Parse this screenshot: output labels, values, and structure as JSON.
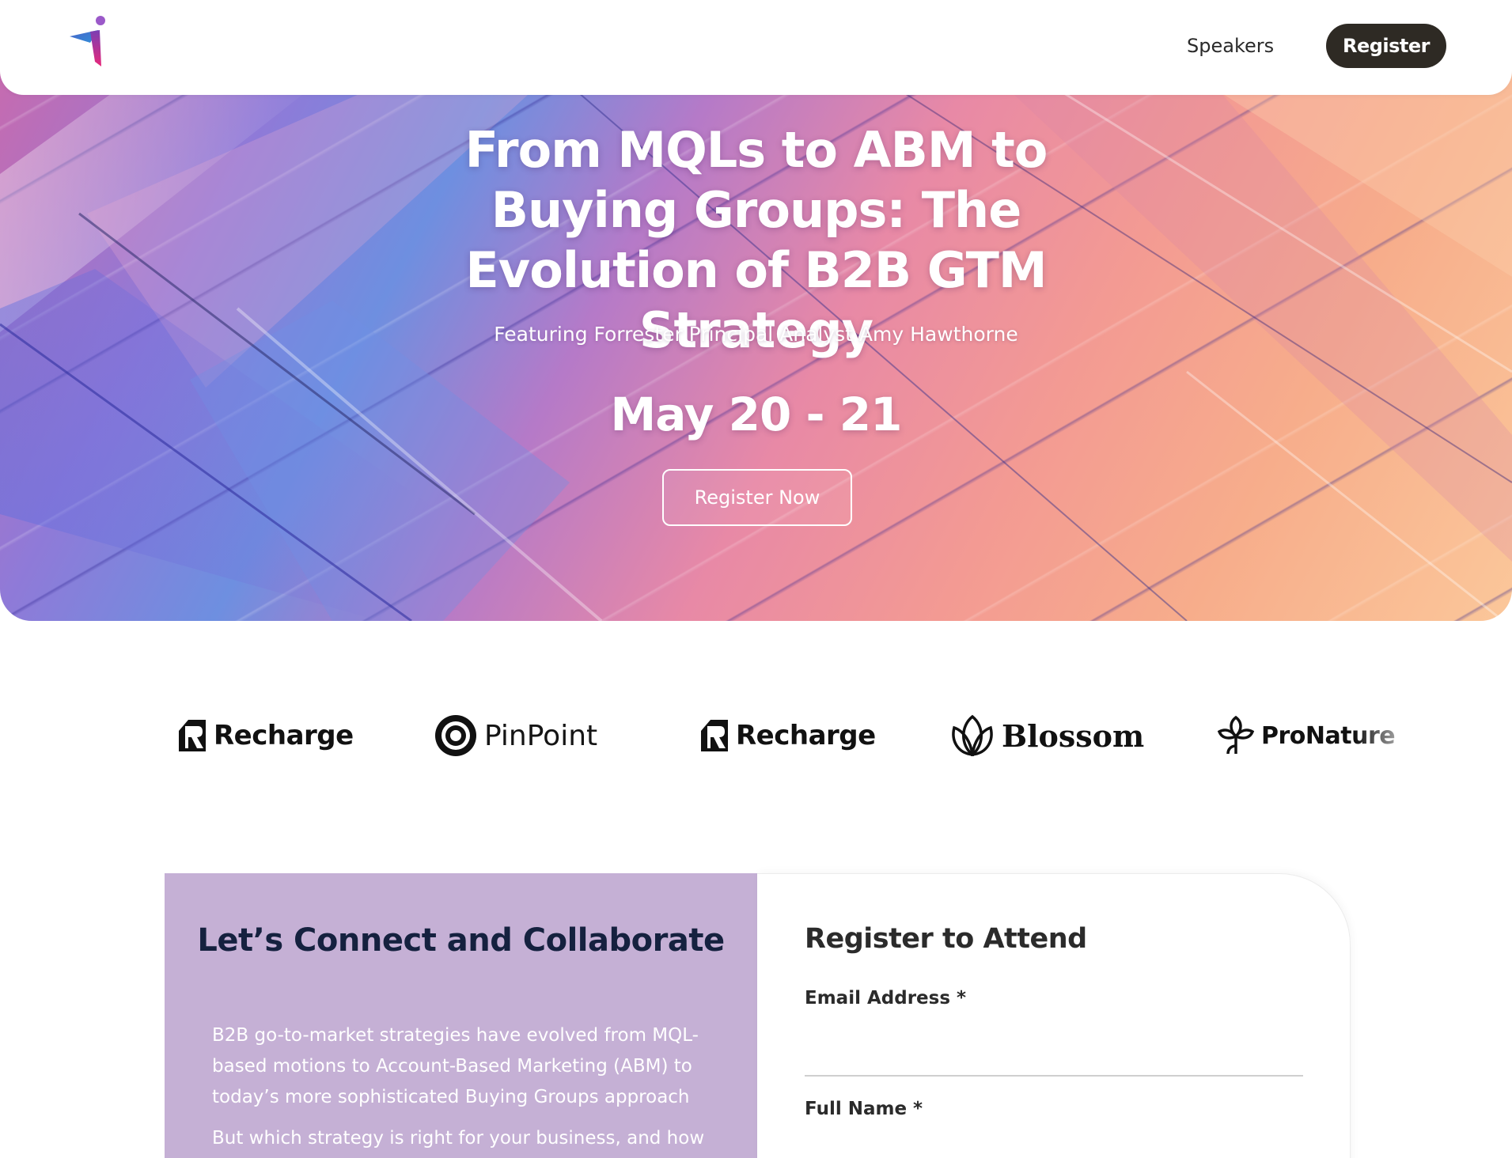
{
  "header": {
    "nav_speakers": "Speakers",
    "nav_register": "Register"
  },
  "hero": {
    "title": "From MQLs to ABM to Buying Groups: The Evolution of B2B GTM Strategy",
    "subtitle": "Featuring Forrester Principal Analyst Amy Hawthorne",
    "date": "May 20 - 21",
    "cta": "Register Now"
  },
  "logos": [
    {
      "name": "Recharge",
      "icon": "recharge-logo-icon"
    },
    {
      "name": "PinPoint",
      "icon": "pinpoint-logo-icon"
    },
    {
      "name": "Recharge",
      "icon": "recharge-logo-icon"
    },
    {
      "name": "Blossom",
      "icon": "blossom-logo-icon"
    },
    {
      "name": "ProNature",
      "icon": "pronature-logo-icon"
    }
  ],
  "connect": {
    "heading": "Let’s Connect and Collaborate",
    "paragraph1": "B2B go-to-market strategies have evolved from MQL-based motions to Account-Based Marketing (ABM) to today’s more sophisticated Buying Groups approach",
    "paragraph2": "But which strategy is right for your business, and how"
  },
  "form": {
    "heading": "Register to Attend",
    "email_label": "Email Address *",
    "name_label": "Full Name *"
  },
  "colors": {
    "register_button": "#2e2a24",
    "card_left_bg": "#c5b0d5",
    "heading_navy": "#15213f"
  }
}
